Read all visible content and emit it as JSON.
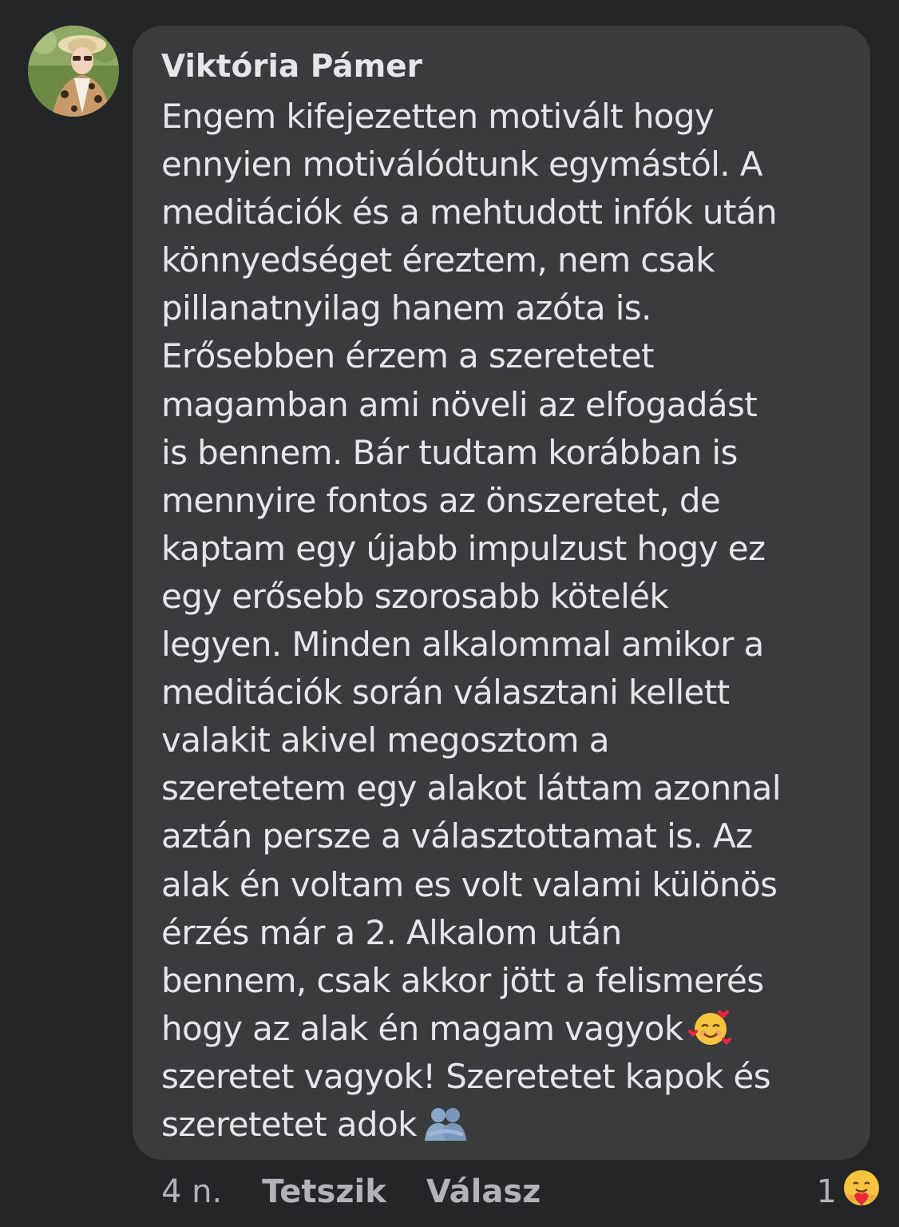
{
  "comment": {
    "author": "Viktória Pámer",
    "lines": [
      "Engem kifejezetten motivált hogy",
      "ennyien motiválódtunk egymástól. A",
      "meditációk és a mehtudott infók után",
      "könnyedséget éreztem, nem csak",
      "pillanatnyilag hanem azóta is.",
      "Erősebben érzem a szeretetet",
      "magamban ami növeli az elfogadást",
      "is bennem. Bár tudtam korábban is",
      "mennyire fontos az önszeretet, de",
      "kaptam egy újabb impulzust hogy ez",
      "egy erősebb szorosabb kötelék",
      "legyen. Minden alkalommal amikor a",
      "meditációk során választani kellett",
      "valakit akivel megosztom a",
      "szeretetem egy alakot láttam azonnal",
      "aztán persze a választottamat is. Az",
      "alak én voltam es volt valami különös",
      "érzés  már a 2. Alkalom után",
      "bennem, csak akkor  jött a felismerés",
      "hogy az alak én magam vagyok",
      "szeretet vagyok! Szeretetet kapok és",
      "szeretetet adok"
    ],
    "inline_emojis": [
      "smiling-face-with-hearts-emoji",
      "people-hugging-emoji"
    ]
  },
  "actions": {
    "time": "4 n.",
    "like": "Tetszik",
    "reply": "Válasz"
  },
  "reaction": {
    "count": "1",
    "icon": "care-reaction-icon"
  },
  "colors": {
    "background": "#242526",
    "bubble": "#3a3b3c",
    "text": "#e4e6eb",
    "secondary": "#b0b3b8"
  }
}
